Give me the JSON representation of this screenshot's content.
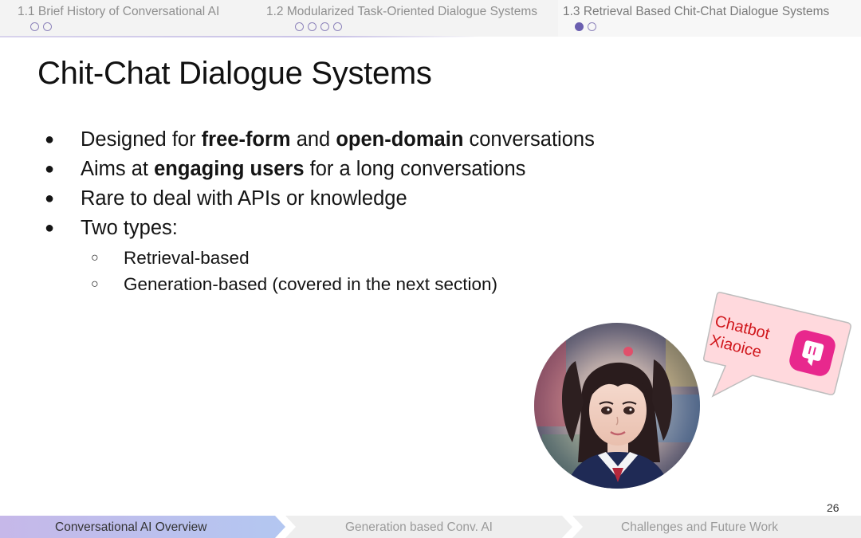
{
  "nav": {
    "sections": [
      {
        "label": "1.1 Brief History of Conversational AI",
        "dots": 2,
        "filled": 0
      },
      {
        "label": "1.2 Modularized Task-Oriented Dialogue Systems",
        "dots": 4,
        "filled": 0
      },
      {
        "label": "1.3 Retrieval Based Chit-Chat Dialogue Systems",
        "dots": 2,
        "filled": 1
      }
    ]
  },
  "slide": {
    "title": "Chit-Chat Dialogue Systems",
    "bullets": [
      {
        "segments": [
          {
            "t": "Designed for "
          },
          {
            "t": "free-form",
            "b": true
          },
          {
            "t": " and "
          },
          {
            "t": "open-domain",
            "b": true
          },
          {
            "t": " conversations"
          }
        ]
      },
      {
        "segments": [
          {
            "t": "Aims at "
          },
          {
            "t": "engaging users",
            "b": true
          },
          {
            "t": " for a long conversations"
          }
        ]
      },
      {
        "segments": [
          {
            "t": "Rare to deal with APIs or knowledge"
          }
        ]
      },
      {
        "segments": [
          {
            "t": "Two types:"
          }
        ]
      }
    ],
    "sub_bullets": [
      "Retrieval-based",
      "Generation-based (covered in the next section)"
    ],
    "bubble": {
      "line1": "Chatbot",
      "line2": "Xiaoice"
    },
    "page_number": "26"
  },
  "footer": {
    "sections": [
      {
        "label": "Conversational AI Overview",
        "active": true
      },
      {
        "label": "Generation based Conv. AI",
        "active": false
      },
      {
        "label": "Challenges and Future Work",
        "active": false
      }
    ]
  },
  "colors": {
    "accent": "#6b5fb0",
    "footer_active": "#b9c3ef",
    "bubble_fill": "#ffd9dd",
    "bubble_text": "#d0161b",
    "app_icon": "#e8288d"
  }
}
